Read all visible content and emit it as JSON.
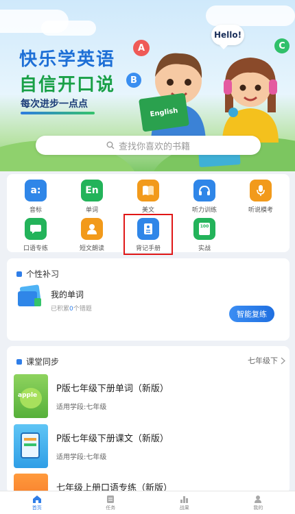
{
  "banner": {
    "title_line1": "快乐学英语",
    "title_line2": "自信开口说",
    "slogan": "每次进步一点点",
    "letters": [
      "A",
      "B",
      "C"
    ],
    "speech_bubble": "Hello!",
    "book_text": "English"
  },
  "search": {
    "placeholder": "查找你喜欢的书籍"
  },
  "features": [
    {
      "label": "音标",
      "icon": "phonetic-icon",
      "glyph": "a:",
      "color": "#2f86e8"
    },
    {
      "label": "单词",
      "icon": "word-icon",
      "glyph": "En",
      "color": "#23b35a"
    },
    {
      "label": "美文",
      "icon": "book-icon",
      "glyph": "",
      "color": "#f29a1b"
    },
    {
      "label": "听力训练",
      "icon": "headphones-icon",
      "glyph": "",
      "color": "#2f86e8"
    },
    {
      "label": "听说模考",
      "icon": "microphone-icon",
      "glyph": "",
      "color": "#f29a1b"
    },
    {
      "label": "口语专练",
      "icon": "speech-icon",
      "glyph": "",
      "color": "#23b35a"
    },
    {
      "label": "短文朗读",
      "icon": "reader-icon",
      "glyph": "",
      "color": "#f29a1b"
    },
    {
      "label": "背记手册",
      "icon": "notebook-icon",
      "glyph": "",
      "color": "#2f86e8"
    },
    {
      "label": "实战",
      "icon": "practice-icon",
      "glyph": "100",
      "color": "#23b35a"
    }
  ],
  "review": {
    "title": "个性补习",
    "item_title": "我的单词",
    "stats_prefix": "已积累",
    "stats_count": "0",
    "stats_suffix": "个错题",
    "button": "智能复练"
  },
  "sync": {
    "title": "课堂同步",
    "grade_selector": "七年级下",
    "books": [
      {
        "title": "P版七年级下册单词（新版）",
        "subtitle": "适用学段:七年级",
        "cover": "apple",
        "cover_text": "apple"
      },
      {
        "title": "P版七年级下册课文（新版）",
        "subtitle": "适用学段:七年级",
        "cover": "tablet",
        "cover_text": ""
      },
      {
        "title": "七年级上册口语专练（新版）",
        "subtitle": "",
        "cover": "orange",
        "cover_text": ""
      }
    ]
  },
  "nav": [
    {
      "label": "首页",
      "icon": "home-icon",
      "active": true
    },
    {
      "label": "任务",
      "icon": "task-icon",
      "active": false
    },
    {
      "label": "战果",
      "icon": "bar-chart-icon",
      "active": false
    },
    {
      "label": "我的",
      "icon": "user-icon",
      "active": false
    }
  ],
  "colors": {
    "primary": "#2f7ee8",
    "highlight_box": "#e01616",
    "green": "#23b35a",
    "orange": "#f29a1b"
  }
}
